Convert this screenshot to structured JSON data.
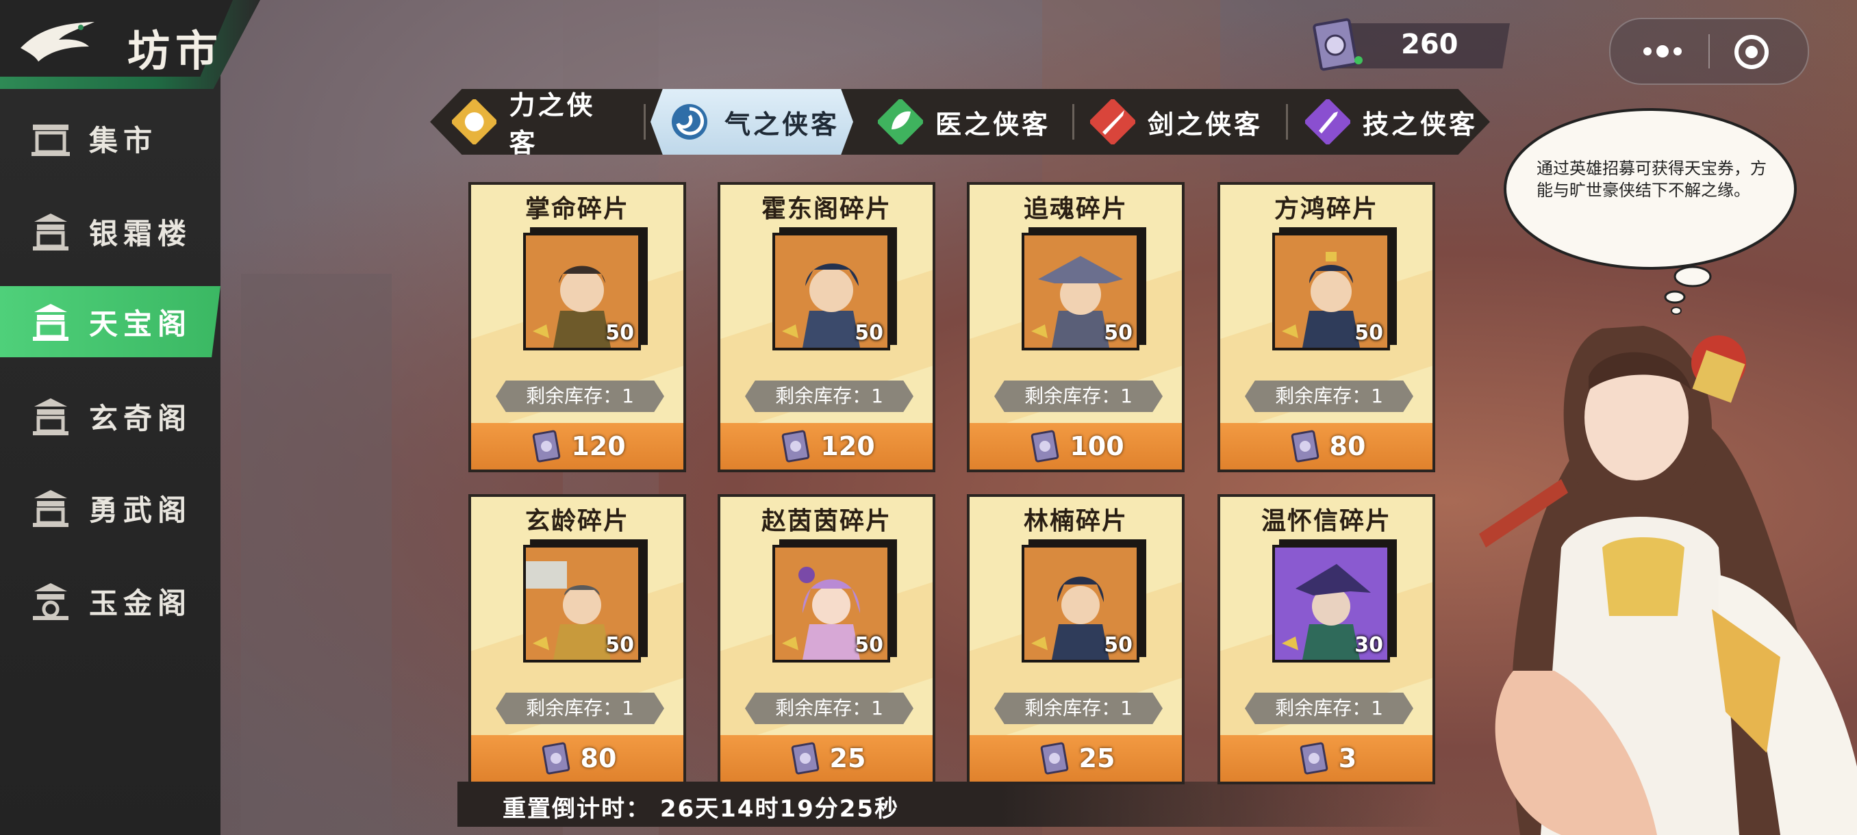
{
  "header": {
    "title": "坊市",
    "currency_value": "260"
  },
  "sidebar": {
    "items": [
      {
        "label": "集市",
        "icon": "market-stall-icon"
      },
      {
        "label": "银霜楼",
        "icon": "pavilion-icon"
      },
      {
        "label": "天宝阁",
        "icon": "treasure-hall-icon",
        "active": true
      },
      {
        "label": "玄奇阁",
        "icon": "pavilion-icon"
      },
      {
        "label": "勇武阁",
        "icon": "pavilion-icon"
      },
      {
        "label": "玉金阁",
        "icon": "pavilion-icon"
      }
    ]
  },
  "tabs": [
    {
      "label": "力之侠客",
      "icon": "fist-icon"
    },
    {
      "label": "气之侠客",
      "icon": "swirl-icon",
      "active": true
    },
    {
      "label": "医之侠客",
      "icon": "leaf-icon"
    },
    {
      "label": "剑之侠客",
      "icon": "sword-icon"
    },
    {
      "label": "技之侠客",
      "icon": "dagger-icon"
    }
  ],
  "cards": [
    {
      "name": "掌命碎片",
      "qty": "50",
      "stock": "剩余库存：1",
      "price": "120"
    },
    {
      "name": "霍东阁碎片",
      "qty": "50",
      "stock": "剩余库存：1",
      "price": "120"
    },
    {
      "name": "追魂碎片",
      "qty": "50",
      "stock": "剩余库存：1",
      "price": "100"
    },
    {
      "name": "方鸿碎片",
      "qty": "50",
      "stock": "剩余库存：1",
      "price": "80"
    },
    {
      "name": "玄龄碎片",
      "qty": "50",
      "stock": "剩余库存：1",
      "price": "80"
    },
    {
      "name": "赵茵茵碎片",
      "qty": "50",
      "stock": "剩余库存：1",
      "price": "25"
    },
    {
      "name": "林楠碎片",
      "qty": "50",
      "stock": "剩余库存：1",
      "price": "25"
    },
    {
      "name": "温怀信碎片",
      "qty": "30",
      "stock": "剩余库存：1",
      "price": "3"
    }
  ],
  "countdown": "重置倒计时：  26天14时19分25秒",
  "speech": "通过英雄招募可获得天宝券，方能与旷世豪侠结下不解之缘。",
  "colors": {
    "accent_green": "#3bb863",
    "card_bg": "#f7e9b3",
    "price_orange": "#e0822d",
    "tab_active": "#cfe3f1"
  }
}
